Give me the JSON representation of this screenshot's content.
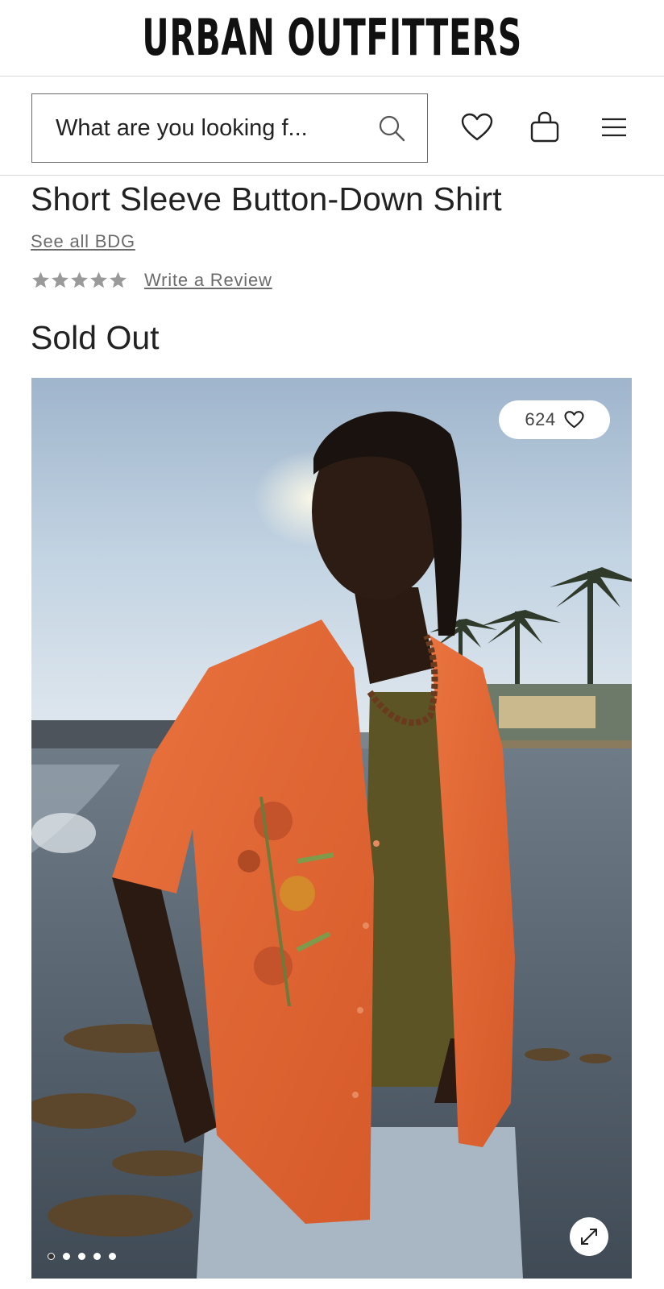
{
  "header": {
    "brand": "URBAN OUTFITTERS",
    "search_placeholder": "What are you looking f..."
  },
  "icons": {
    "search": "search-icon",
    "wishlist": "heart-icon",
    "bag": "shopping-bag-icon",
    "menu": "hamburger-menu-icon",
    "expand": "expand-icon"
  },
  "product": {
    "title": "Short Sleeve Button-Down Shirt",
    "brand_link": "See all BDG",
    "rating_stars": 0,
    "rating_max": 5,
    "review_link": "Write a Review",
    "status": "Sold Out",
    "likes": "624",
    "image_count": 5,
    "active_image": 1
  },
  "colors": {
    "text": "#222222",
    "link": "#6b6b6b",
    "star_empty": "#9a9a9a",
    "border": "#d9d9d9"
  }
}
